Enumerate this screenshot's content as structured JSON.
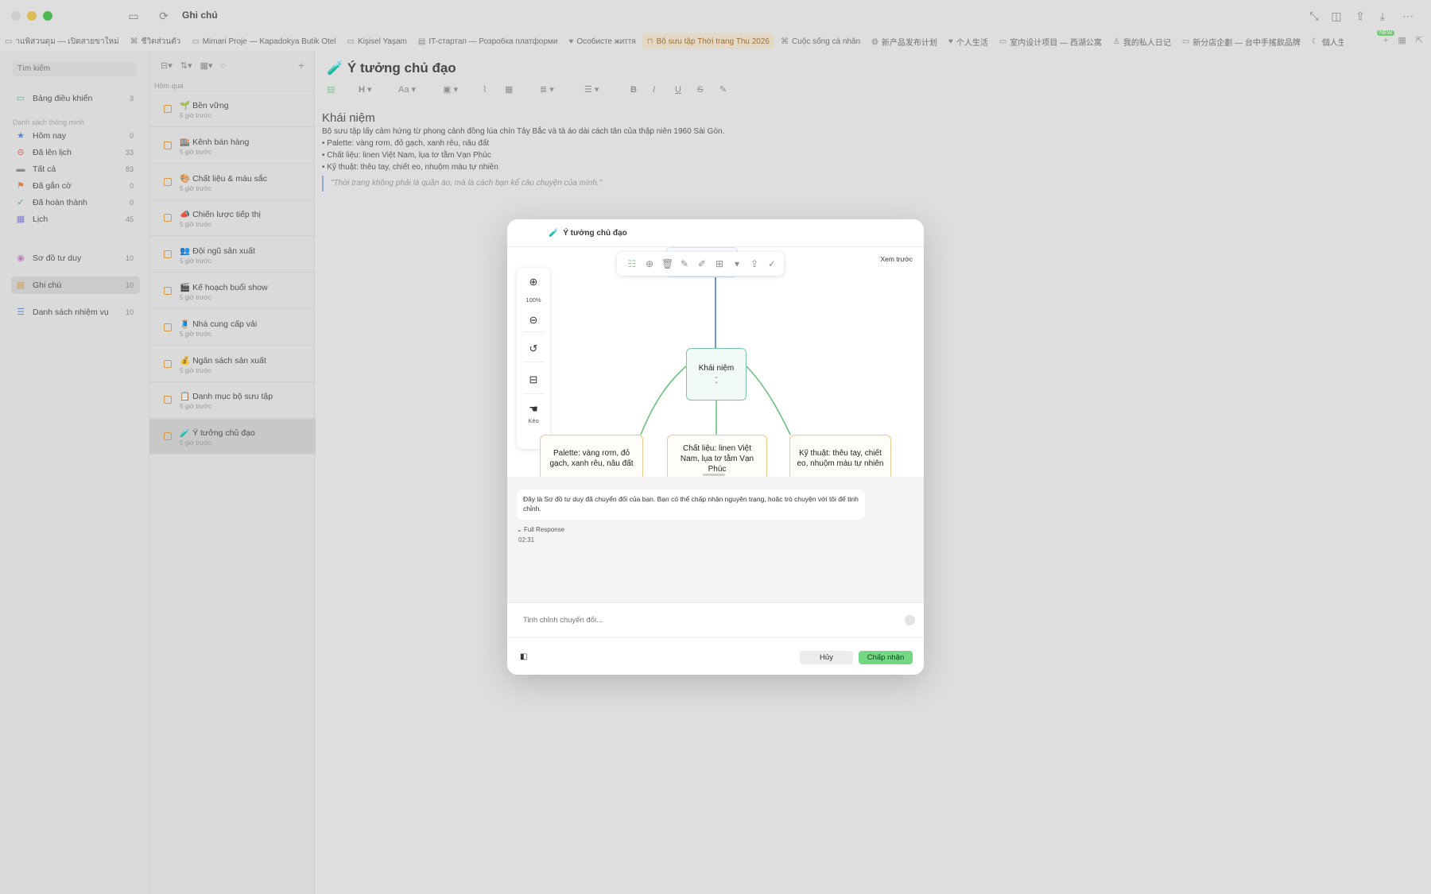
{
  "app": {
    "title": "Ghi chú"
  },
  "tabs": [
    {
      "label": "าแพิสวนดุม — เปิดสายขาใหม่",
      "icon": "folder"
    },
    {
      "label": "ชีวิตส่วนตัว",
      "icon": "link"
    },
    {
      "label": "Mimari Proje — Kapadokya Butik Otel",
      "icon": "folder"
    },
    {
      "label": "Kişisel Yaşam",
      "icon": "folder"
    },
    {
      "label": "IT-стартап — Розробка платформи",
      "icon": "doc"
    },
    {
      "label": "Особисте життя",
      "icon": "heart"
    },
    {
      "label": "Bộ sưu tập Thời trang Thu 2026",
      "icon": "bag",
      "active": true
    },
    {
      "label": "Cuộc sống cá nhân",
      "icon": "link"
    },
    {
      "label": "新产品发布计划",
      "icon": "globe"
    },
    {
      "label": "个人生活",
      "icon": "heart"
    },
    {
      "label": "室内设计项目 — 西湖公寓",
      "icon": "folder"
    },
    {
      "label": "我的私人日记",
      "icon": "pin"
    },
    {
      "label": "新分店企劃 — 台中手搖飲品牌",
      "icon": "folder"
    },
    {
      "label": "個人生活",
      "icon": "moon"
    }
  ],
  "tabs_badge": "NEW",
  "sidebar": {
    "search_placeholder": "Tìm kiếm",
    "dashboard": {
      "label": "Bảng điều khiển",
      "count": "3"
    },
    "section_label": "Danh sách thông minh",
    "smart": [
      {
        "label": "Hôm nay",
        "count": "0",
        "color": "#4a86d9"
      },
      {
        "label": "Đã lên lịch",
        "count": "33",
        "color": "#e05050"
      },
      {
        "label": "Tất cả",
        "count": "83",
        "color": "#8a8a8a"
      },
      {
        "label": "Đã gắn cờ",
        "count": "0",
        "color": "#e0803a"
      },
      {
        "label": "Đã hoàn thành",
        "count": "0",
        "color": "#3fb26a"
      },
      {
        "label": "Lịch",
        "count": "45",
        "color": "#7a7ad6"
      }
    ],
    "mindmap": {
      "label": "Sơ đồ tư duy",
      "count": "10"
    },
    "notes": {
      "label": "Ghi chú",
      "count": "10"
    },
    "tasks": {
      "label": "Danh sách nhiệm vụ",
      "count": "10"
    }
  },
  "notes_list": {
    "date_header": "Hôm qua",
    "items": [
      {
        "emoji": "🌱",
        "title": "Bền vững",
        "time": "5 giờ trước"
      },
      {
        "emoji": "🏬",
        "title": "Kênh bán hàng",
        "time": "5 giờ trước"
      },
      {
        "emoji": "🎨",
        "title": "Chất liệu & màu sắc",
        "time": "5 giờ trước"
      },
      {
        "emoji": "📣",
        "title": "Chiến lược tiếp thị",
        "time": "5 giờ trước"
      },
      {
        "emoji": "👥",
        "title": "Đội ngũ sản xuất",
        "time": "5 giờ trước"
      },
      {
        "emoji": "🎬",
        "title": "Kế hoạch buổi show",
        "time": "5 giờ trước"
      },
      {
        "emoji": "🧵",
        "title": "Nhà cung cấp vải",
        "time": "5 giờ trước"
      },
      {
        "emoji": "💰",
        "title": "Ngân sách sản xuất",
        "time": "5 giờ trước"
      },
      {
        "emoji": "📋",
        "title": "Danh mục bộ sưu tập",
        "time": "5 giờ trước"
      },
      {
        "emoji": "🧪",
        "title": "Ý tưởng chủ đạo",
        "time": "5 giờ trước",
        "active": true
      }
    ]
  },
  "editor": {
    "title": "Ý tưởng chủ đạo",
    "title_emoji": "🧪",
    "toolbar": {
      "heading": "H",
      "font": "Aa",
      "bold": "B",
      "italic": "I",
      "underline": "U",
      "strike": "S"
    },
    "heading": "Khái niệm",
    "paragraphs": [
      "Bộ sưu tập lấy cảm hứng từ phong cảnh đồng lúa chín Tây Bắc và tà áo dài cách tân của thập niên 1960 Sài Gòn.",
      "• Palette: vàng rơm, đỏ gạch, xanh rêu, nâu đất",
      "• Chất liệu: linen Việt Nam, lụa tơ tằm Vạn Phúc",
      "• Kỹ thuật: thêu tay, chiết eo, nhuộm màu tự nhiên"
    ],
    "quote": "\"Thời trang không phải là quần áo, mà là cách bạn kể câu chuyện của mình.\""
  },
  "modal": {
    "title": "Ý tưởng chủ đạo",
    "title_emoji": "🧪",
    "preview_label": "Xem trước",
    "zoom_level": "100%",
    "drag_label": "Kéo",
    "mindmap": {
      "center": "Khái niệm",
      "children": [
        "Palette: vàng rơm, đỏ gạch, xanh rêu, nâu đất",
        "Chất liệu: linen Việt Nam, lụa tơ tằm Vạn Phúc",
        "Kỹ thuật: thêu tay, chiết eo, nhuộm màu tự nhiên"
      ]
    },
    "message": "Đây là Sơ đồ tư duy đã chuyển đổi của bạn. Bạn có thể chấp nhận nguyên trạng, hoặc trò chuyện với tôi để tinh chỉnh.",
    "full_response_label": "Full Response",
    "timestamp": "02:31",
    "refine_placeholder": "Tinh chỉnh chuyển đổi...",
    "cancel_label": "Hủy",
    "accept_label": "Chấp nhận"
  }
}
